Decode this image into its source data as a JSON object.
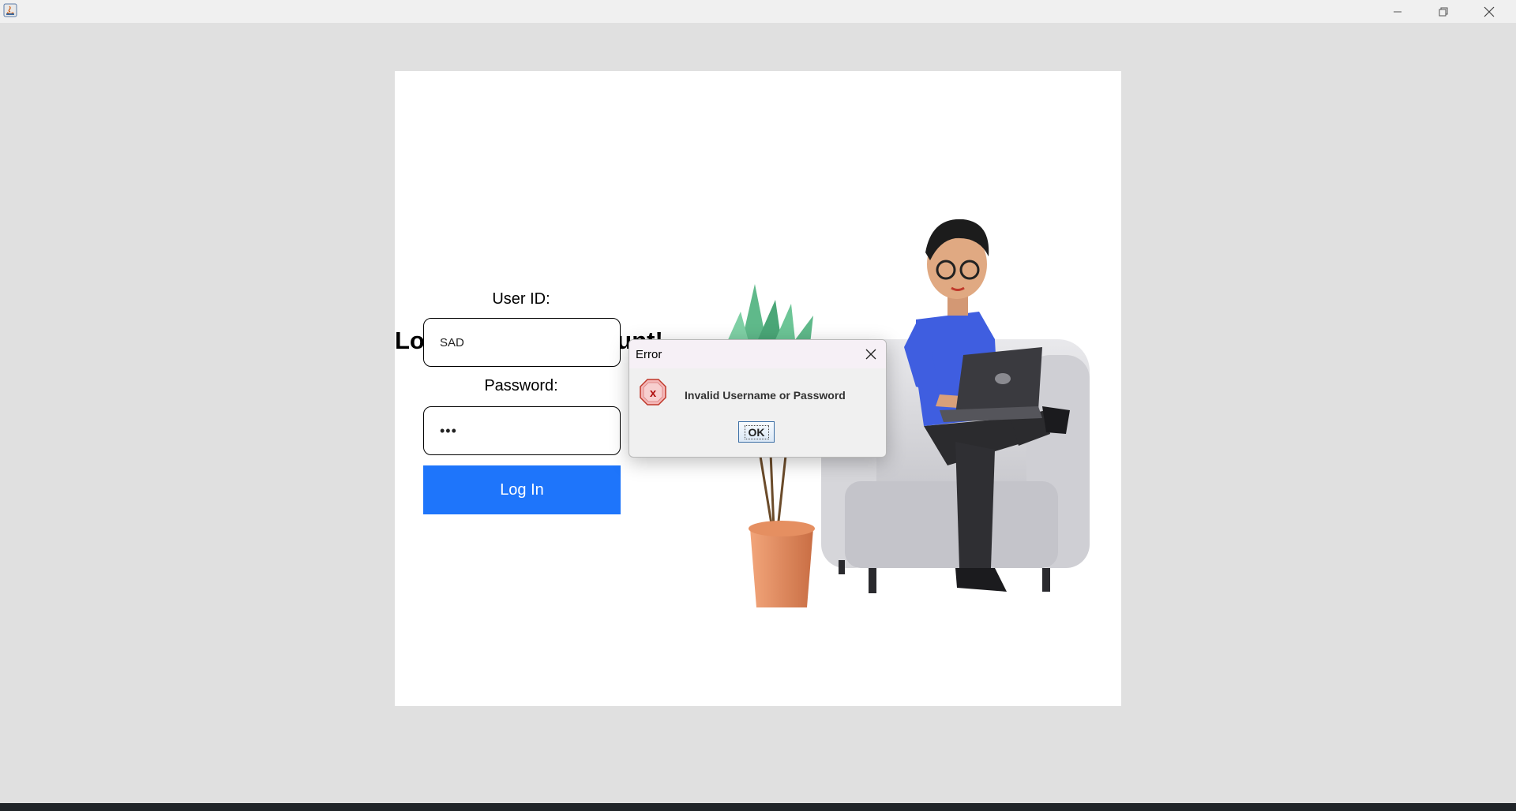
{
  "window": {
    "minimize_icon": "minimize-icon",
    "maximize_icon": "restore-icon",
    "close_icon": "close-icon",
    "app_icon": "java-icon"
  },
  "login": {
    "heading": "Login to your Account!",
    "userid_label": "User ID:",
    "userid_value": "SAD",
    "password_label": "Password:",
    "password_value": "•••",
    "login_button": "Log In",
    "button_color": "#1e75fb"
  },
  "dialog": {
    "title": "Error",
    "message": "Invalid Username or Password",
    "ok_label": "OK",
    "icon": "error-icon"
  }
}
